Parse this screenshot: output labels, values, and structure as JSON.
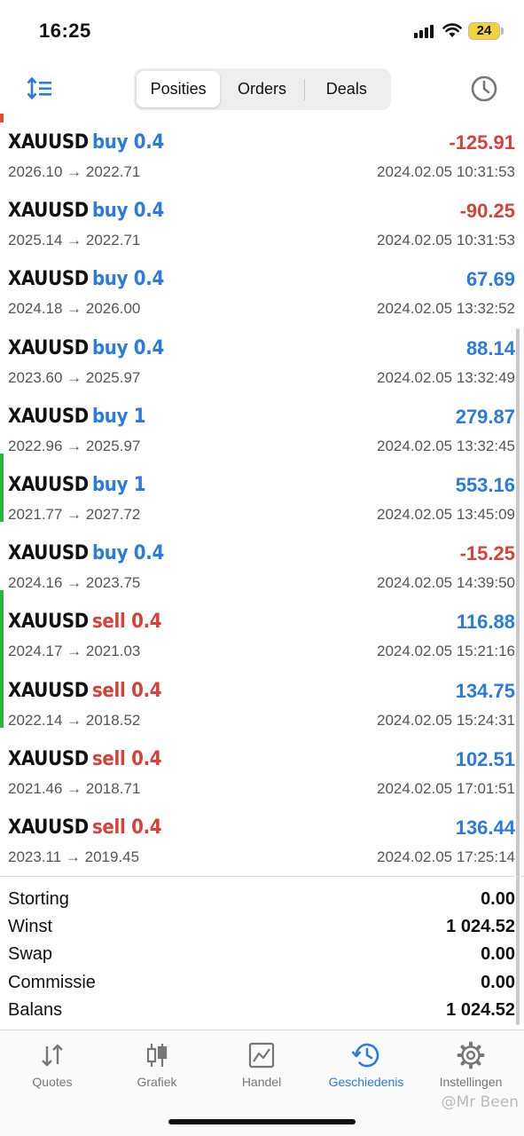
{
  "status_bar": {
    "time": "16:25",
    "battery": "24"
  },
  "toolbar": {
    "tabs": [
      {
        "label": "Posities"
      },
      {
        "label": "Orders"
      },
      {
        "label": "Deals"
      }
    ]
  },
  "deals": [
    {
      "symbol": "XAUUSD",
      "direction": "buy 0.4",
      "prices": "2026.10 → 2022.71",
      "profit": "-125.91",
      "time": "2024.02.05 10:31:53"
    },
    {
      "symbol": "XAUUSD",
      "direction": "buy 0.4",
      "prices": "2025.14 → 2022.71",
      "profit": "-90.25",
      "time": "2024.02.05 10:31:53"
    },
    {
      "symbol": "XAUUSD",
      "direction": "buy 0.4",
      "prices": "2024.18 → 2026.00",
      "profit": "67.69",
      "time": "2024.02.05 13:32:52"
    },
    {
      "symbol": "XAUUSD",
      "direction": "buy 0.4",
      "prices": "2023.60 → 2025.97",
      "profit": "88.14",
      "time": "2024.02.05 13:32:49"
    },
    {
      "symbol": "XAUUSD",
      "direction": "buy 1",
      "prices": "2022.96 → 2025.97",
      "profit": "279.87",
      "time": "2024.02.05 13:32:45"
    },
    {
      "symbol": "XAUUSD",
      "direction": "buy 1",
      "prices": "2021.77 → 2027.72",
      "profit": "553.16",
      "time": "2024.02.05 13:45:09"
    },
    {
      "symbol": "XAUUSD",
      "direction": "buy 0.4",
      "prices": "2024.16 → 2023.75",
      "profit": "-15.25",
      "time": "2024.02.05 14:39:50"
    },
    {
      "symbol": "XAUUSD",
      "direction": "sell 0.4",
      "prices": "2024.17 → 2021.03",
      "profit": "116.88",
      "time": "2024.02.05 15:21:16"
    },
    {
      "symbol": "XAUUSD",
      "direction": "sell 0.4",
      "prices": "2022.14 → 2018.52",
      "profit": "134.75",
      "time": "2024.02.05 15:24:31"
    },
    {
      "symbol": "XAUUSD",
      "direction": "sell 0.4",
      "prices": "2021.46 → 2018.71",
      "profit": "102.51",
      "time": "2024.02.05 17:01:51"
    },
    {
      "symbol": "XAUUSD",
      "direction": "sell 0.4",
      "prices": "2023.11 → 2019.45",
      "profit": "136.44",
      "time": "2024.02.05 17:25:14"
    }
  ],
  "summary": [
    {
      "label": "Storting",
      "value": "0.00"
    },
    {
      "label": "Winst",
      "value": "1 024.52"
    },
    {
      "label": "Swap",
      "value": "0.00"
    },
    {
      "label": "Commissie",
      "value": "0.00"
    },
    {
      "label": "Balans",
      "value": "1 024.52"
    }
  ],
  "tabbar": [
    {
      "label": "Quotes",
      "icon": "quotes-icon"
    },
    {
      "label": "Grafiek",
      "icon": "chart-candles-icon"
    },
    {
      "label": "Handel",
      "icon": "trade-icon"
    },
    {
      "label": "Geschiedenis",
      "icon": "history-icon"
    },
    {
      "label": "Instellingen",
      "icon": "gear-icon"
    }
  ],
  "watermark": "@Mr Been",
  "colors": {
    "buy": "#2a7bde",
    "sell": "#d8413a",
    "accent_green": "#27b53a",
    "accent_red": "#e24a3a"
  }
}
